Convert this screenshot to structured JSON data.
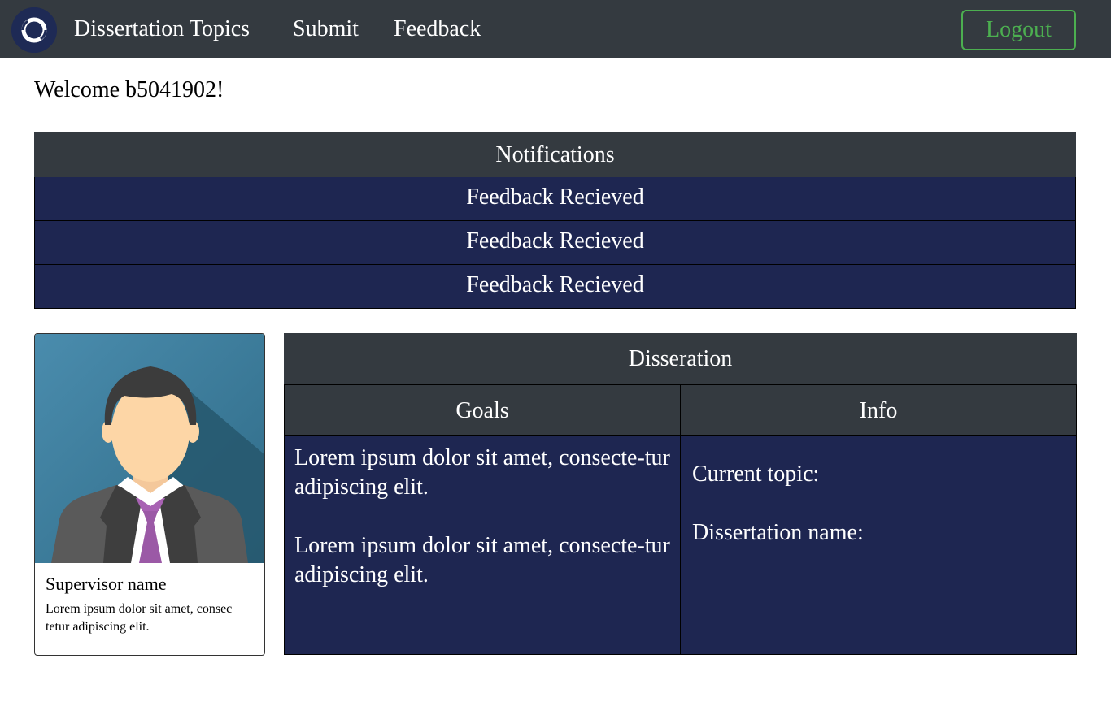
{
  "nav": {
    "logo_icon": "ring-logo-icon",
    "links": [
      "Dissertation Topics",
      "Submit",
      "Feedback"
    ],
    "logout_label": "Logout"
  },
  "welcome": "Welcome b5041902!",
  "notifications": {
    "title": "Notifications",
    "items": [
      "Feedback Recieved",
      "Feedback Recieved",
      "Feedback Recieved"
    ]
  },
  "supervisor": {
    "photo_icon": "businessman-avatar-icon",
    "name": "Supervisor name",
    "description": "Lorem ipsum dolor sit amet, consec tetur adipiscing elit."
  },
  "dissertation": {
    "title": "Disseration",
    "goals_header": "Goals",
    "info_header": "Info",
    "goals": [
      "Lorem ipsum dolor sit amet, consecte-tur adipiscing elit.",
      "Lorem ipsum dolor sit amet, consecte-tur adipiscing elit."
    ],
    "info": [
      "Current topic:",
      "Dissertation name:"
    ]
  },
  "colors": {
    "navbar": "#343a40",
    "panel_blue": "#1e2651",
    "logout_green": "#4caf50"
  }
}
